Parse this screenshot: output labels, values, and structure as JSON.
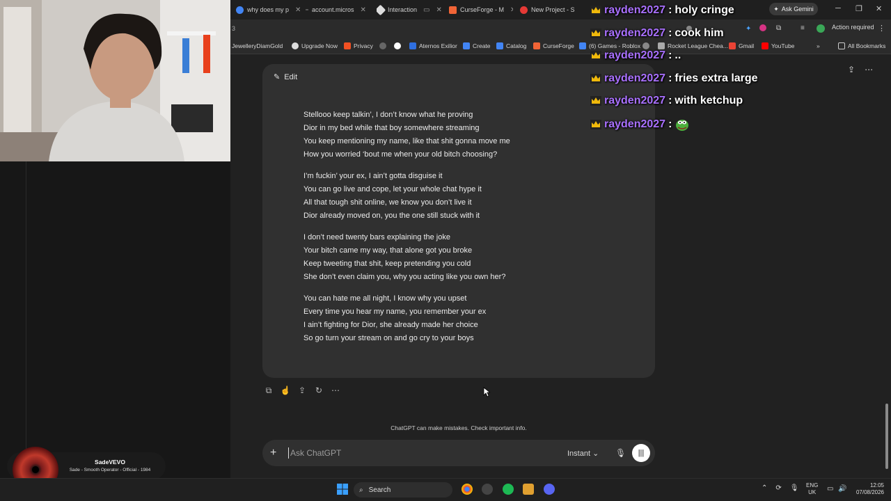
{
  "browser": {
    "tabs": [
      {
        "label": "why does my p",
        "color": "#4285f4"
      },
      {
        "label": "account.micros",
        "color": "#888888"
      },
      {
        "label": "Interaction",
        "color": "#dddddd"
      },
      {
        "label": "CurseForge - M",
        "color": "#f16436"
      },
      {
        "label": "New Project - S",
        "color": "#e53935"
      }
    ],
    "url_fragment": "3",
    "ask_gemini": "Ask Gemini",
    "action_required": "Action required",
    "bookmarks": [
      {
        "label": "JewelleryDiamGold",
        "color": "#888888"
      },
      {
        "label": "Upgrade Now",
        "color": "#dddddd"
      },
      {
        "label": "Privacy",
        "color": "#f25022"
      },
      {
        "label": "",
        "color": "#666666"
      },
      {
        "label": "",
        "color": "#ffffff"
      },
      {
        "label": "Aternos Exilior",
        "color": "#2f6fe0"
      },
      {
        "label": "Create",
        "color": "#4285f4"
      },
      {
        "label": "Catalog",
        "color": "#4285f4"
      },
      {
        "label": "CurseForge",
        "color": "#f16436"
      },
      {
        "label": "(6) Games - Roblox",
        "color": "#4285f4"
      },
      {
        "label": "",
        "color": "#888888"
      },
      {
        "label": "Rocket League Chea...",
        "color": "#aaaaaa"
      },
      {
        "label": "Gmail",
        "color": "#ea4335"
      },
      {
        "label": "YouTube",
        "color": "#ff0000"
      }
    ],
    "all_bookmarks": "All Bookmarks"
  },
  "stream_chat": [
    {
      "user": "rayden2027",
      "message": "holy cringe"
    },
    {
      "user": "rayden2027",
      "message": "cook him"
    },
    {
      "user": "rayden2027",
      "message": ".."
    },
    {
      "user": "rayden2027",
      "message": "fries extra large"
    },
    {
      "user": "rayden2027",
      "message": "with ketchup"
    },
    {
      "user": "rayden2027",
      "message": ""
    }
  ],
  "conversation": {
    "edit_label": "Edit",
    "stanzas": [
      [
        "Stellooo keep talkin’, I don’t know what he proving",
        "Dior in my bed while that boy somewhere streaming",
        "You keep mentioning my name, like that shit gonna move me",
        "How you worried ‘bout me when your old bitch choosing?"
      ],
      [
        "I’m fuckin’ your ex, I ain’t gotta disguise it",
        "You can go live and cope, let your whole chat hype it",
        "All that tough shit online, we know you don’t live it",
        "Dior already moved on, you the one still stuck with it"
      ],
      [
        "I don’t need twenty bars explaining the joke",
        "Your bitch came my way, that alone got you broke",
        "Keep tweeting that shit, keep pretending you cold",
        "She don’t even claim you, why you acting like you own her?"
      ],
      [
        "You can hate me all night, I know why you upset",
        "Every time you hear my name, you remember your ex",
        "I ain’t fighting for Dior, she already made her choice",
        "So go turn your stream on and go cry to your boys"
      ]
    ],
    "disclaimer": "ChatGPT can make mistakes. Check important info.",
    "composer_placeholder": "Ask ChatGPT",
    "model_label": "Instant"
  },
  "music": {
    "artist": "SadeVEVO",
    "title": "Sade - Smooth Operator - Official - 1984"
  },
  "taskbar": {
    "search_label": "Search",
    "lang_top": "ENG",
    "lang_bottom": "UK",
    "time": "12:05",
    "date": "07/08/2026"
  }
}
